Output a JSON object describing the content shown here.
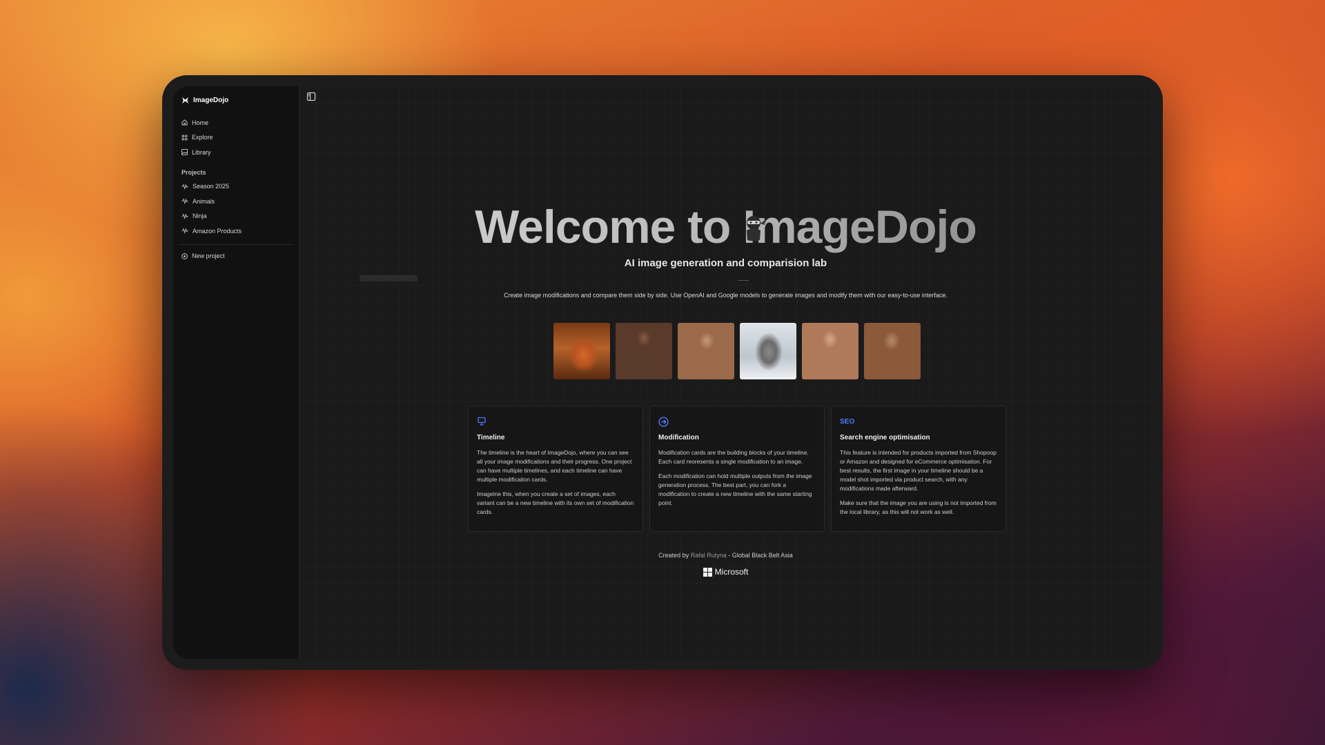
{
  "sidebar": {
    "brand": "ImageDojo",
    "nav": [
      {
        "label": "Home",
        "icon": "home-icon"
      },
      {
        "label": "Explore",
        "icon": "grid-icon"
      },
      {
        "label": "Library",
        "icon": "image-icon"
      }
    ],
    "projects_heading": "Projects",
    "projects": [
      {
        "label": "Season 2025",
        "icon": "waveform-icon"
      },
      {
        "label": "Animals",
        "icon": "waveform-icon"
      },
      {
        "label": "Ninja",
        "icon": "waveform-icon"
      },
      {
        "label": "Amazon Products",
        "icon": "waveform-icon"
      }
    ],
    "new_project": "New project"
  },
  "hero": {
    "title": "Welcome to ImageDojo",
    "subtitle": "AI image generation and comparision lab",
    "description": "Create image modifications and compare them side by side. Use OpenAI and Google models to generate images and modify them with our easy-to-use interface."
  },
  "gallery": [
    {
      "subject": "fox in autumn forest"
    },
    {
      "subject": "woman in red dress"
    },
    {
      "subject": "man at laptop"
    },
    {
      "subject": "wolf in snow"
    },
    {
      "subject": "woman with sunglasses and flowers"
    },
    {
      "subject": "man with power drill"
    }
  ],
  "cards": [
    {
      "icon": "presentation-icon",
      "title": "Timeline",
      "p1": "The timeline is the heart of ImageDojo, where you can see all your image modifications and their progress. One project can have multiple timelines, and each timeline can have multiple modification cards.",
      "p2": "Imageine this, when you create a set of images, each variant can be a new timeline with its own set of modification cards."
    },
    {
      "icon": "arrow-circle-icon",
      "title": "Modification",
      "p1": "Modification cards are the building blocks of your timeline. Each card reoresents a single modification to an image.",
      "p2": "Each modification can hold multiple outputs from the image generation process. The best part, you can fork a modification to create a new timeline with the same starting point."
    },
    {
      "icon": "seo-icon",
      "icon_text": "SEO",
      "title": "Search engine optimisation",
      "p1": "This feature is intended for products imported from Shopoop or Amazon and designed for eCommerce optimisation. For best results, the first image in your timeline should be a model shot imported via product search, with any modifications made afterward.",
      "p2": "Make sure that the image you are using is not imported from the local library, as this will not work as well."
    }
  ],
  "footer": {
    "created_by": "Created by",
    "author": "Rafal Rutyna",
    "suffix": "- Global Black Belt Asia",
    "logo_label": "Microsoft"
  },
  "colors": {
    "accent": "#4f7cff",
    "sidebar_bg": "#111111",
    "main_bg": "#1a1a1a"
  }
}
